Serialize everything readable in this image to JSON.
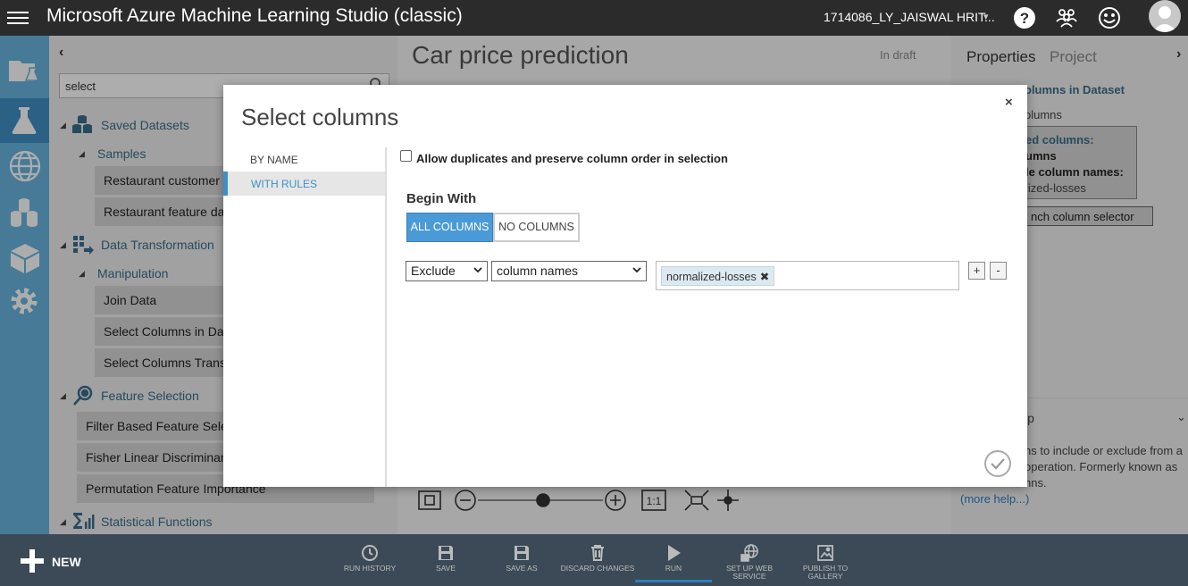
{
  "app": {
    "title": "Microsoft Azure Machine Learning Studio (classic)",
    "user": "1714086_LY_JAISWAL HRIT...",
    "user_caret": "▾"
  },
  "palette": {
    "collapse_glyph": "‹",
    "search_value": "select",
    "categories": {
      "saved_datasets": "Saved Datasets",
      "samples": "Samples",
      "data_transformation": "Data Transformation",
      "manipulation": "Manipulation",
      "feature_selection": "Feature Selection",
      "statistical_functions": "Statistical Functions"
    },
    "modules": {
      "restaurant_customer": "Restaurant customer data",
      "restaurant_feature": "Restaurant feature data",
      "join_data": "Join Data",
      "select_columns_dataset": "Select Columns in Dataset",
      "select_columns_transform": "Select Columns Transform",
      "filter_based": "Filter Based Feature Selection",
      "fisher_lda": "Fisher Linear Discriminant Analysis",
      "permutation": "Permutation Feature Importance"
    }
  },
  "canvas": {
    "experiment_title": "Car price prediction",
    "status": "In draft",
    "zoom_fit_label": "1:1"
  },
  "properties": {
    "tab_properties": "Properties",
    "tab_project": "Project",
    "expand_glyph": "›",
    "module_name": "olumns in Dataset",
    "sub": "olumns",
    "box_l1": "ed columns:",
    "box_l2": "umns",
    "box_l3": "le column names:",
    "box_l4": "lized-losses",
    "launch_selector": "nch column selector",
    "help_header": "lp",
    "help_chevron": "⌄",
    "help_line1": "ns to include or exclude from a",
    "help_line2": "operation. Formerly known as",
    "help_line3": "nns.",
    "more_help": "(more help...)"
  },
  "bottombar": {
    "new_label": "NEW",
    "commands": {
      "run_history": [
        "RUN HISTORY"
      ],
      "save": [
        "SAVE"
      ],
      "save_as": [
        "SAVE AS"
      ],
      "discard": [
        "DISCARD CHANGES"
      ],
      "run": [
        "RUN"
      ],
      "web_service_1": "SET UP WEB",
      "web_service_2": "SERVICE",
      "publish_1": "PUBLISH TO",
      "publish_2": "GALLERY"
    }
  },
  "modal": {
    "title": "Select columns",
    "close_glyph": "×",
    "tabs": {
      "by_name": "BY NAME",
      "with_rules": "WITH RULES"
    },
    "allow_duplicates_label": "Allow duplicates and preserve column order in selection",
    "begin_with_label": "Begin With",
    "all_columns": "ALL COLUMNS",
    "no_columns": "NO COLUMNS",
    "rule": {
      "action": "Exclude",
      "type": "column names",
      "tags": [
        "normalized-losses"
      ],
      "tag_remove_glyph": "✖",
      "add_glyph": "+",
      "remove_glyph": "-"
    }
  },
  "colors": {
    "accent": "#3e8fc4",
    "nav_rail": "#67b4dd",
    "topbar": "#2b2b2b",
    "bottombar": "#3c4a57"
  }
}
